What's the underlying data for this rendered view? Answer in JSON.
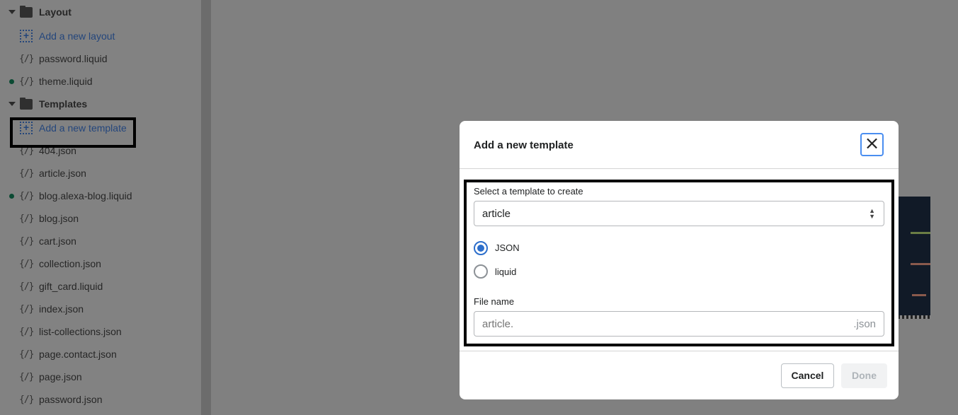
{
  "sidebar": {
    "layout_folder": "Layout",
    "add_layout": "Add a new layout",
    "layout_files": [
      {
        "name": "password.liquid",
        "modified": false
      },
      {
        "name": "theme.liquid",
        "modified": true
      }
    ],
    "templates_folder": "Templates",
    "add_template": "Add a new template",
    "template_files": [
      {
        "name": "404.json",
        "modified": false
      },
      {
        "name": "article.json",
        "modified": false
      },
      {
        "name": "blog.alexa-blog.liquid",
        "modified": true
      },
      {
        "name": "blog.json",
        "modified": false
      },
      {
        "name": "cart.json",
        "modified": false
      },
      {
        "name": "collection.json",
        "modified": false
      },
      {
        "name": "gift_card.liquid",
        "modified": false
      },
      {
        "name": "index.json",
        "modified": false
      },
      {
        "name": "list-collections.json",
        "modified": false
      },
      {
        "name": "page.contact.json",
        "modified": false
      },
      {
        "name": "page.json",
        "modified": false
      },
      {
        "name": "password.json",
        "modified": false
      }
    ],
    "file_icon": "{/}"
  },
  "modal": {
    "title": "Add a new template",
    "close_icon": "×",
    "select_label": "Select a template to create",
    "select_value": "article",
    "format_options": [
      {
        "label": "JSON",
        "selected": true
      },
      {
        "label": "liquid",
        "selected": false
      }
    ],
    "file_name_label": "File name",
    "file_name_placeholder": "article.",
    "file_name_suffix": ".json",
    "cancel_label": "Cancel",
    "done_label": "Done"
  },
  "colors": {
    "accent": "#2c6ecb",
    "link": "#24467c",
    "modified_dot": "#0b4a33"
  }
}
